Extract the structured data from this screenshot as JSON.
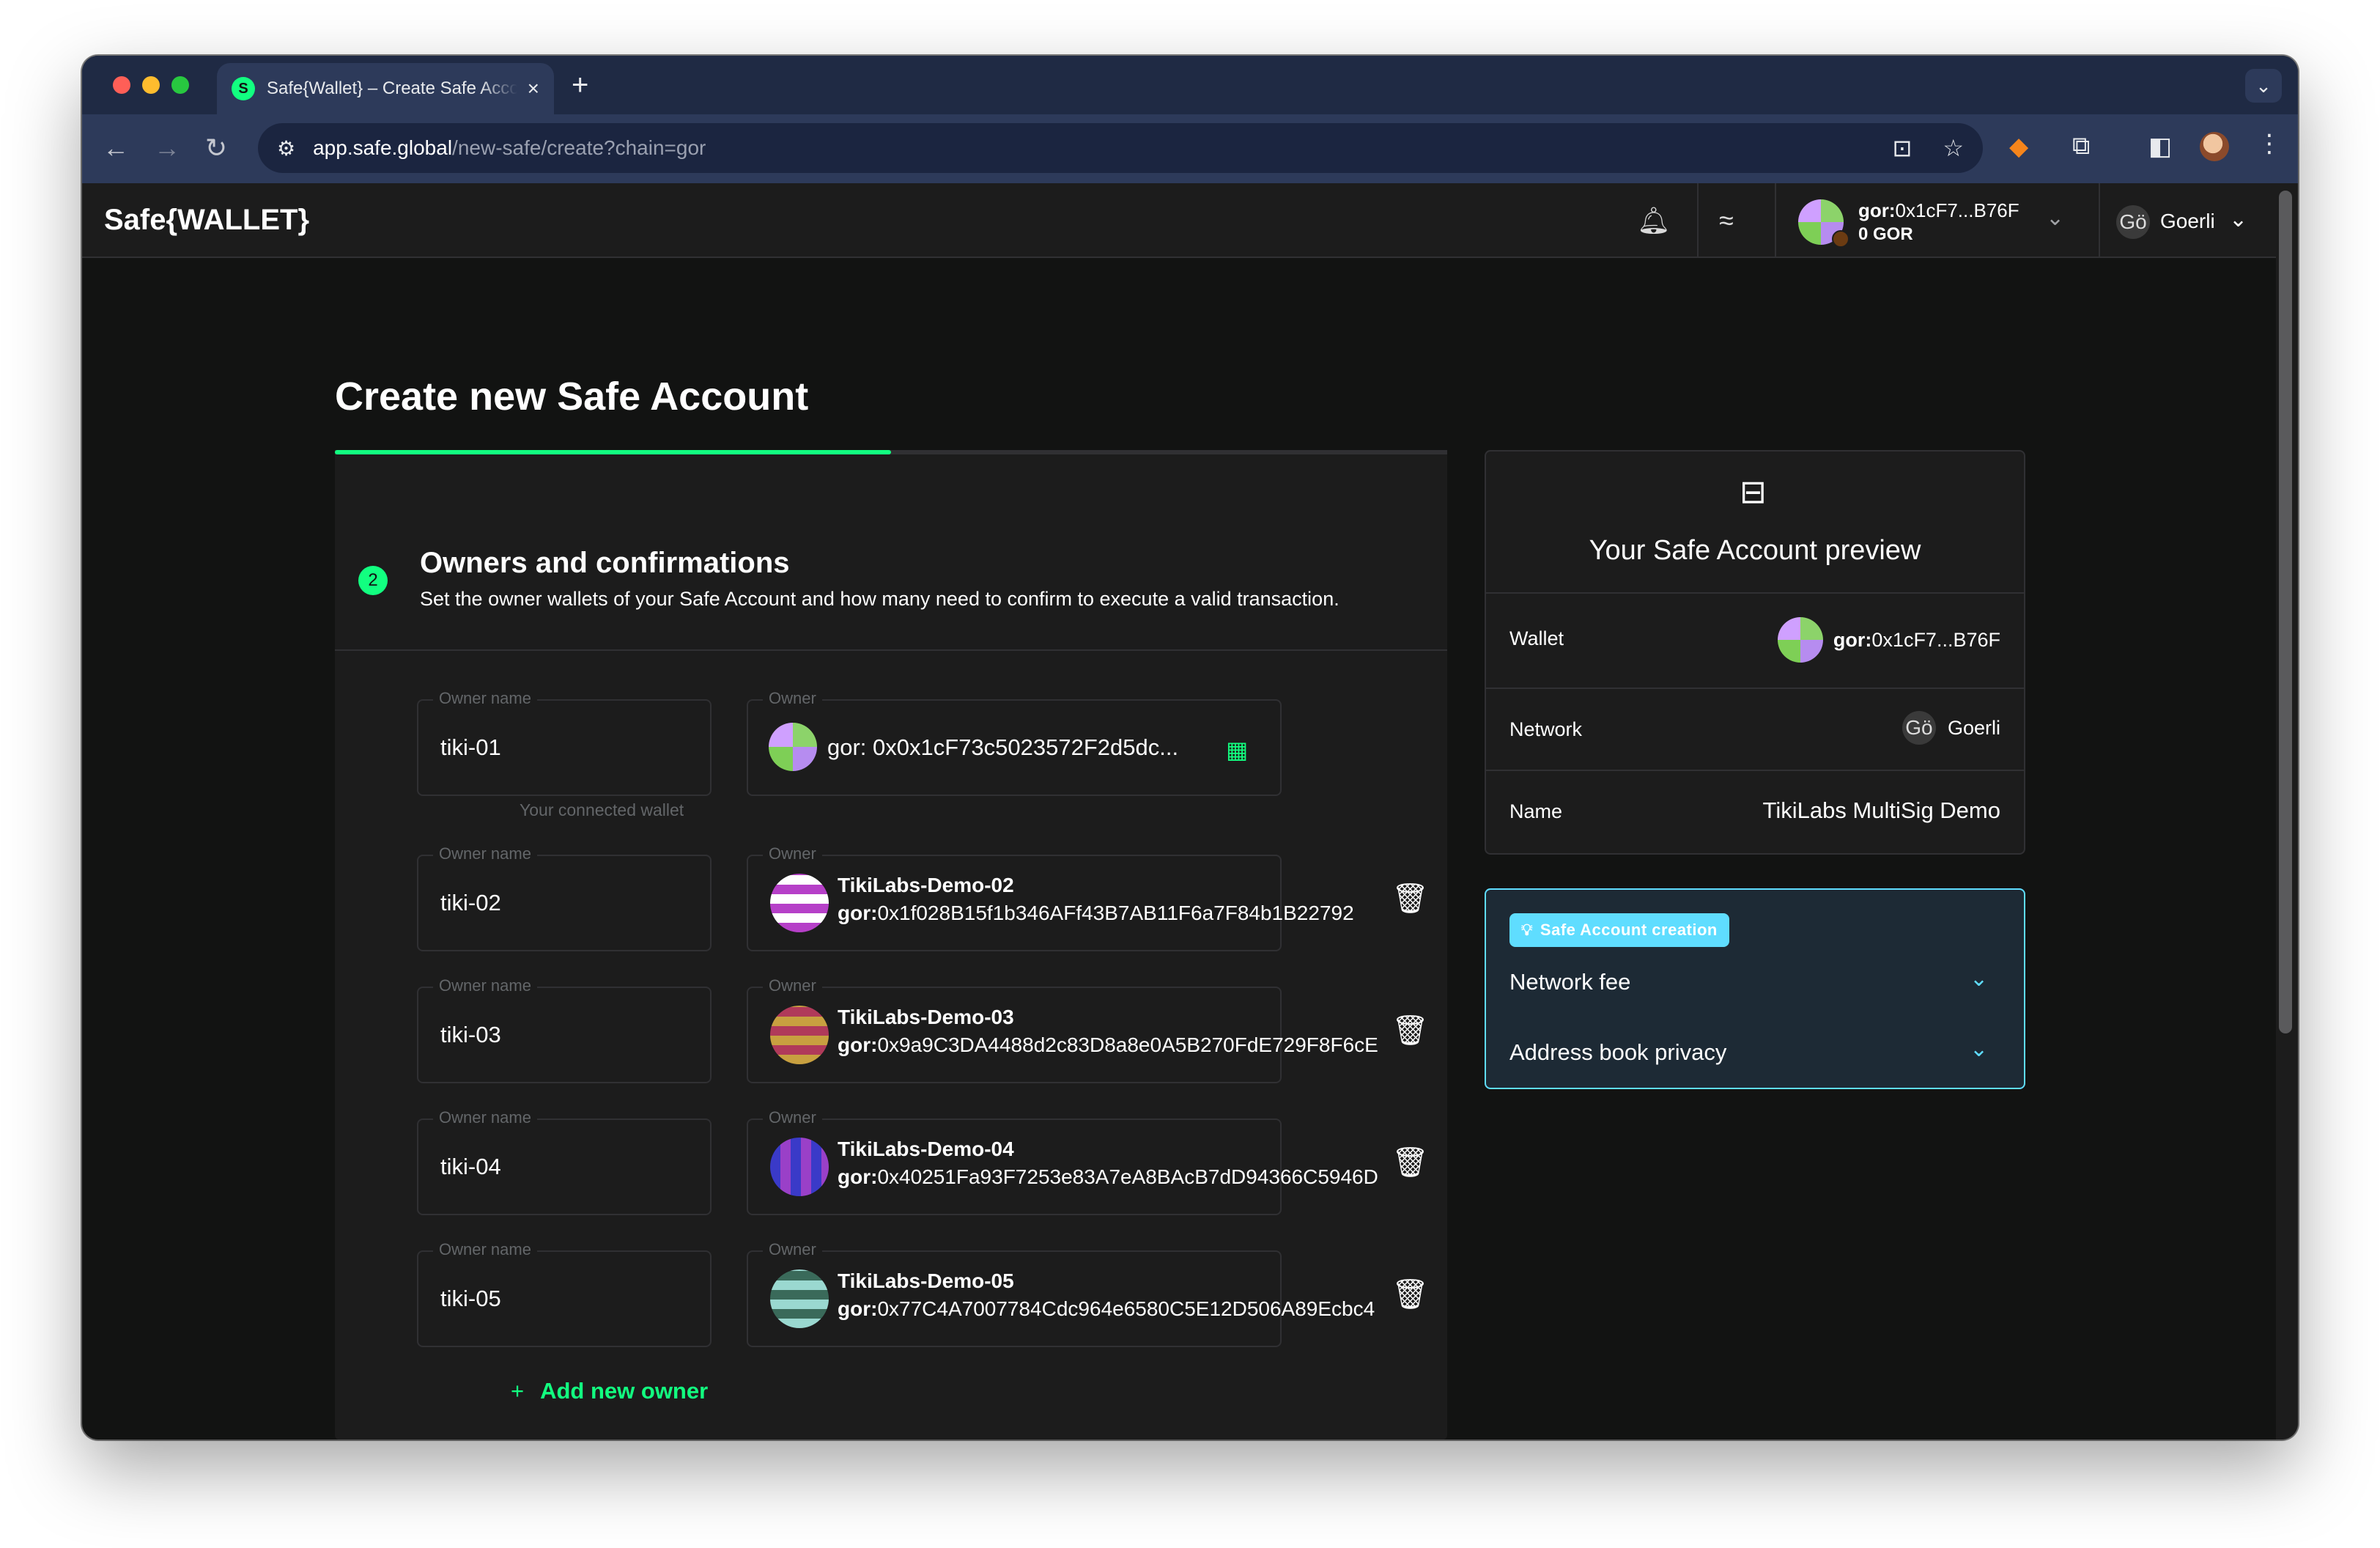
{
  "browser": {
    "tab_title": "Safe{Wallet} – Create Safe Account",
    "url_host": "app.safe.global",
    "url_path": "/new-safe/create?chain=gor"
  },
  "header": {
    "logo": "Safe{WALLET}",
    "account_prefix": "gor:",
    "account_address": "0x1cF7...B76F",
    "account_balance": "0 GOR",
    "network_badge": "Gö",
    "network_name": "Goerli"
  },
  "page": {
    "title": "Create new Safe Account",
    "progress_percent": 50
  },
  "step": {
    "number": "2",
    "title": "Owners and confirmations",
    "subtitle": "Set the owner wallets of your Safe Account and how many need to confirm to execute a valid transaction."
  },
  "owners": {
    "name_label": "Owner name",
    "owner_label": "Owner",
    "connected_helper": "Your connected wallet",
    "first": {
      "name": "tiki-01",
      "address": "gor: 0x0x1cF73c5023572F2d5dc..."
    },
    "rows": [
      {
        "name": "tiki-02",
        "display": "TikiLabs-Demo-02",
        "prefix": "gor:",
        "address": "0x1f028B15f1b346AFf43B7AB11F6a7F84b1B22792"
      },
      {
        "name": "tiki-03",
        "display": "TikiLabs-Demo-03",
        "prefix": "gor:",
        "address": "0x9a9C3DA4488d2c83D8a8e0A5B270FdE729F8F6cE"
      },
      {
        "name": "tiki-04",
        "display": "TikiLabs-Demo-04",
        "prefix": "gor:",
        "address": "0x40251Fa93F7253e83A7eA8BAcB7dD94366C5946D"
      },
      {
        "name": "tiki-05",
        "display": "TikiLabs-Demo-05",
        "prefix": "gor:",
        "address": "0x77C4A7007784Cdc964e6580C5E12D506A89Ecbc4"
      }
    ],
    "add_label": "Add new owner"
  },
  "preview": {
    "title": "Your Safe Account preview",
    "wallet_label": "Wallet",
    "wallet_prefix": "gor:",
    "wallet_value": "0x1cF7...B76F",
    "network_label": "Network",
    "network_badge": "Gö",
    "network_value": "Goerli",
    "name_label": "Name",
    "name_value": "TikiLabs MultiSig Demo"
  },
  "info": {
    "chip": "Safe Account creation",
    "items": [
      "Network fee",
      "Address book privacy"
    ]
  },
  "colors": {
    "accent_green": "#12ff80",
    "info_blue": "#5fddff",
    "background": "#121312",
    "card": "#1c1c1c"
  }
}
